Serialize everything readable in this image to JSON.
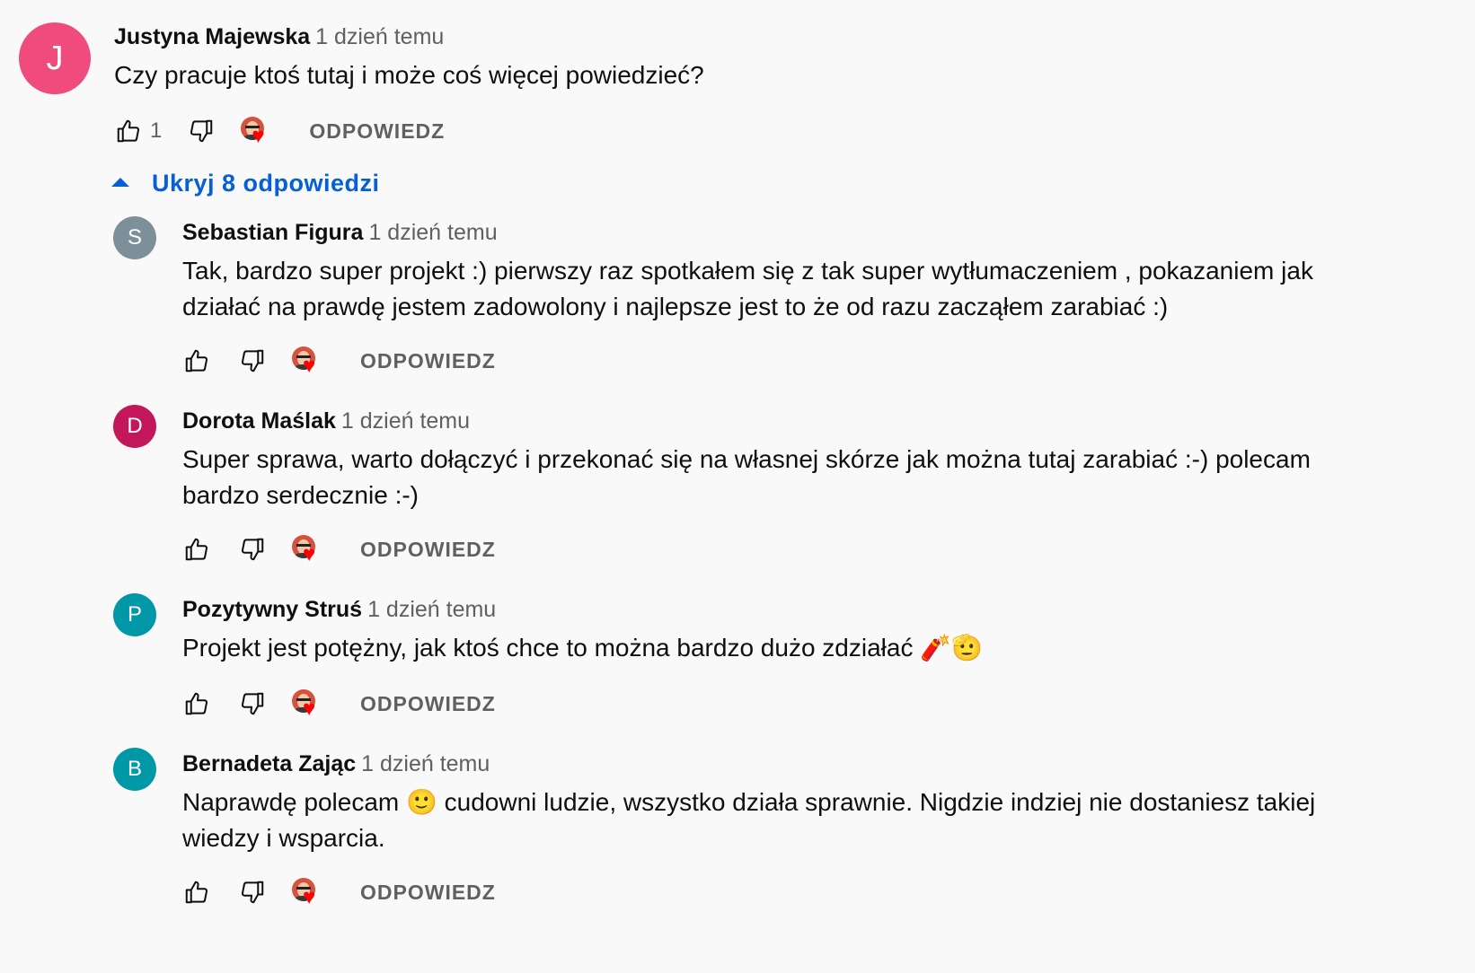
{
  "top_comment": {
    "avatar_letter": "J",
    "avatar_color": "#ef4b7d",
    "author": "Justyna Majewska",
    "time": "1 dzień temu",
    "text": "Czy pracuje ktoś tutaj i może coś więcej powiedzieć?",
    "like_count": "1",
    "reply_label": "ODPOWIEDZ"
  },
  "replies_toggle": {
    "label": "Ukryj 8 odpowiedzi"
  },
  "replies": [
    {
      "avatar_letter": "S",
      "avatar_color": "#7d8f99",
      "author": "Sebastian Figura",
      "time": "1 dzień temu",
      "text": "Tak, bardzo super projekt :) pierwszy raz spotkałem się z tak super wytłumaczeniem , pokazaniem jak działać na prawdę jestem zadowolony i najlepsze jest to że od razu zacząłem zarabiać :)",
      "reply_label": "ODPOWIEDZ"
    },
    {
      "avatar_letter": "D",
      "avatar_color": "#c2185b",
      "author": "Dorota Maślak",
      "time": "1 dzień temu",
      "text": "Super sprawa, warto dołączyć i przekonać się na własnej skórze jak można tutaj zarabiać :-) polecam bardzo serdecznie :-)",
      "reply_label": "ODPOWIEDZ"
    },
    {
      "avatar_letter": "P",
      "avatar_color": "#0097a7",
      "author": "Pozytywny Struś",
      "time": "1 dzień temu",
      "text": "Projekt jest potężny, jak ktoś chce to można bardzo dużo zdziałać 🧨🫡",
      "reply_label": "ODPOWIEDZ"
    },
    {
      "avatar_letter": "B",
      "avatar_color": "#0097a7",
      "author": "Bernadeta Zając",
      "time": "1 dzień temu",
      "text": "Naprawdę polecam 🙂 cudowni ludzie, wszystko działa sprawnie. Nigdzie indziej nie dostaniesz takiej wiedzy i wsparcia.",
      "reply_label": "ODPOWIEDZ"
    }
  ],
  "icons": {
    "like": "thumbs-up-icon",
    "dislike": "thumbs-down-icon",
    "creator_heart": "creator-heart-icon",
    "collapse": "caret-up-icon"
  }
}
